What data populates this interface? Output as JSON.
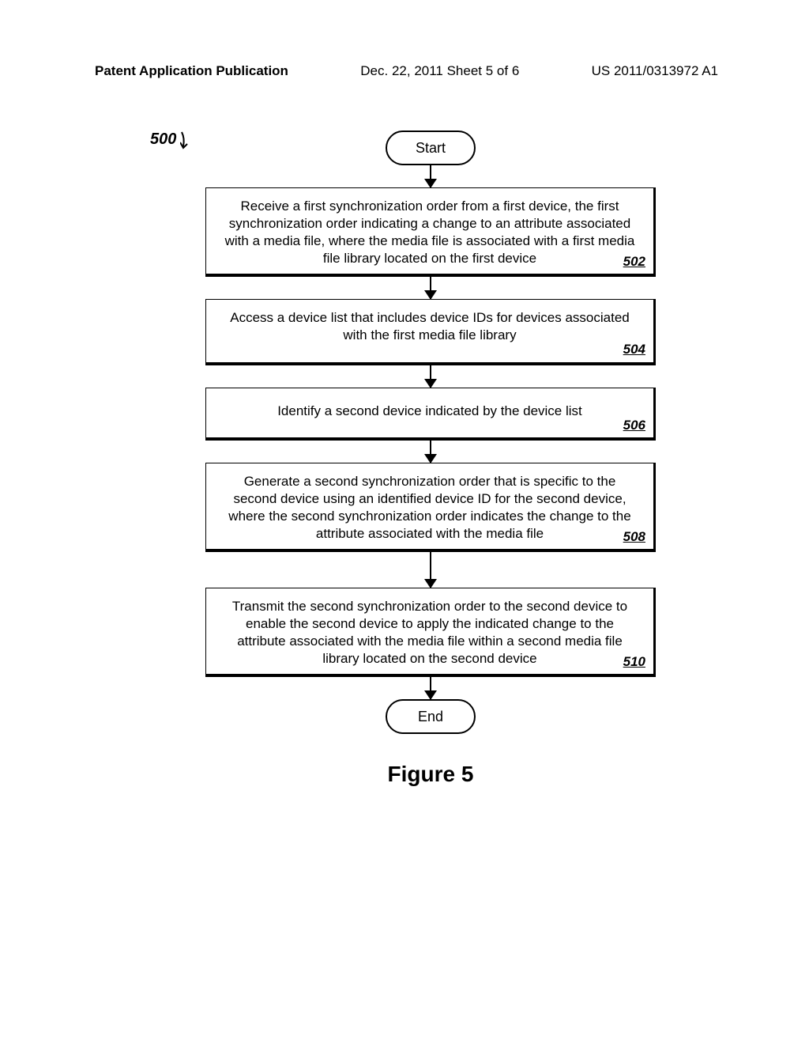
{
  "header": {
    "left": "Patent Application Publication",
    "center": "Dec. 22, 2011  Sheet 5 of 6",
    "right": "US 2011/0313972 A1"
  },
  "ref_label": "500",
  "terminators": {
    "start": "Start",
    "end": "End"
  },
  "steps": [
    {
      "text": "Receive a first synchronization order from a first device, the first synchronization order indicating a change to an attribute associated with a media file, where the media file is associated with a first media file library located on the first device",
      "num": "502"
    },
    {
      "text": "Access a device list that includes device IDs for devices associated with the first media file library",
      "num": "504"
    },
    {
      "text": "Identify a second device indicated by the device list",
      "num": "506"
    },
    {
      "text": "Generate a second synchronization order that is specific to the second device using an identified device ID for the second device, where the second synchronization order indicates the change to the attribute associated with the media file",
      "num": "508"
    },
    {
      "text": "Transmit the second synchronization order to the second device to enable the second device to apply the indicated change to the attribute associated with the media file within a second media file library located on the second device",
      "num": "510"
    }
  ],
  "figure_label": "Figure 5"
}
